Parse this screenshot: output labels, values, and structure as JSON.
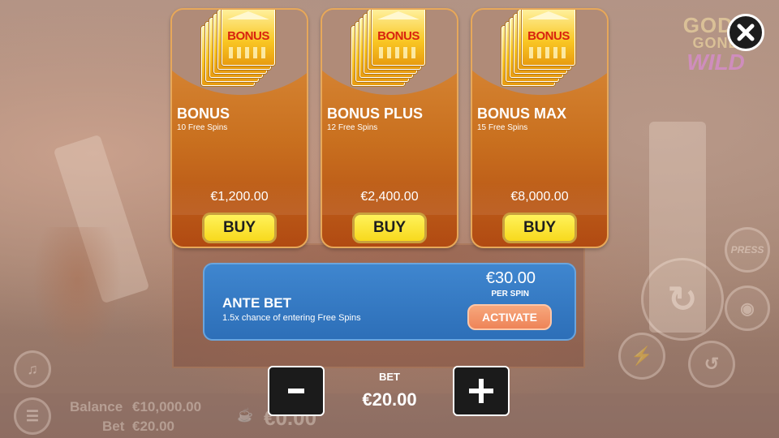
{
  "game_logo": {
    "line1": "GODS",
    "line2": "GONE",
    "line3": "WILD"
  },
  "close_button": {
    "icon": "close-icon"
  },
  "bonus_cards": [
    {
      "badge_text": "BONUS",
      "title": "BONUS",
      "subtitle": "10 Free Spins",
      "price": "€1,200.00",
      "buy_label": "BUY"
    },
    {
      "badge_text": "BONUS",
      "title": "BONUS PLUS",
      "subtitle": "12 Free Spins",
      "price": "€2,400.00",
      "buy_label": "BUY"
    },
    {
      "badge_text": "BONUS",
      "title": "BONUS MAX",
      "subtitle": "15 Free Spins",
      "price": "€8,000.00",
      "buy_label": "BUY"
    }
  ],
  "ante_bet": {
    "title": "ANTE BET",
    "description": "1.5x chance of entering Free Spins",
    "price": "€30.00",
    "price_unit": "PER SPIN",
    "activate_label": "ACTIVATE"
  },
  "bet_control": {
    "label": "BET",
    "value": "€20.00",
    "decrease_label": "-",
    "increase_label": "+"
  },
  "background_hud": {
    "balance_label": "Balance",
    "balance_value": "€10,000.00",
    "bet_label": "Bet",
    "bet_value": "€20.00",
    "win_value": "€0.00",
    "press_label": "PRESS"
  },
  "colors": {
    "card_top": "#de9240",
    "card_bottom": "#b14a12",
    "buy_button": "#f7d91d",
    "ante_panel": "#3f86cf",
    "activate_button": "#ee8458",
    "control_button": "#1b1b1b"
  }
}
